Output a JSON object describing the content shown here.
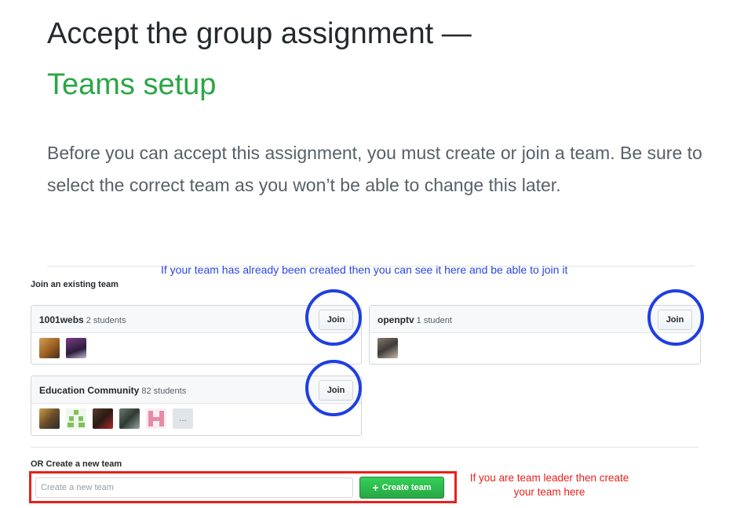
{
  "header": {
    "title_line1": "Accept the group assignment —",
    "title_line2": "Teams setup",
    "title_line2_color": "#28a745"
  },
  "intro": {
    "text": "Before you can accept this assignment, you must create or join a team. Be sure to select the correct team as you won’t be able to change this later."
  },
  "annotations": {
    "join_note": "If your team has already been created then you can see it here and be able to join it",
    "create_note": "If you are team leader then create your team here",
    "highlight_blue": "#1f3fe0",
    "highlight_red": "#e8201a"
  },
  "join_section": {
    "label": "Join an existing team",
    "teams": [
      {
        "name": "1001webs",
        "count": "2 students",
        "join_label": "Join",
        "avatars": [
          "avatar-photo",
          "avatar-photo"
        ]
      },
      {
        "name": "openptv",
        "count": "1 student",
        "join_label": "Join",
        "avatars": [
          "avatar-photo"
        ]
      },
      {
        "name": "Education Community",
        "count": "82 students",
        "join_label": "Join",
        "avatars": [
          "avatar-photo",
          "avatar-identicon-green",
          "avatar-photo",
          "avatar-photo",
          "avatar-identicon-pink"
        ],
        "more_label": "..."
      }
    ]
  },
  "create_section": {
    "label": "OR Create a new team",
    "input_placeholder": "Create a new team",
    "input_value": "",
    "button_label": "Create team",
    "button_icon": "plus-icon"
  }
}
